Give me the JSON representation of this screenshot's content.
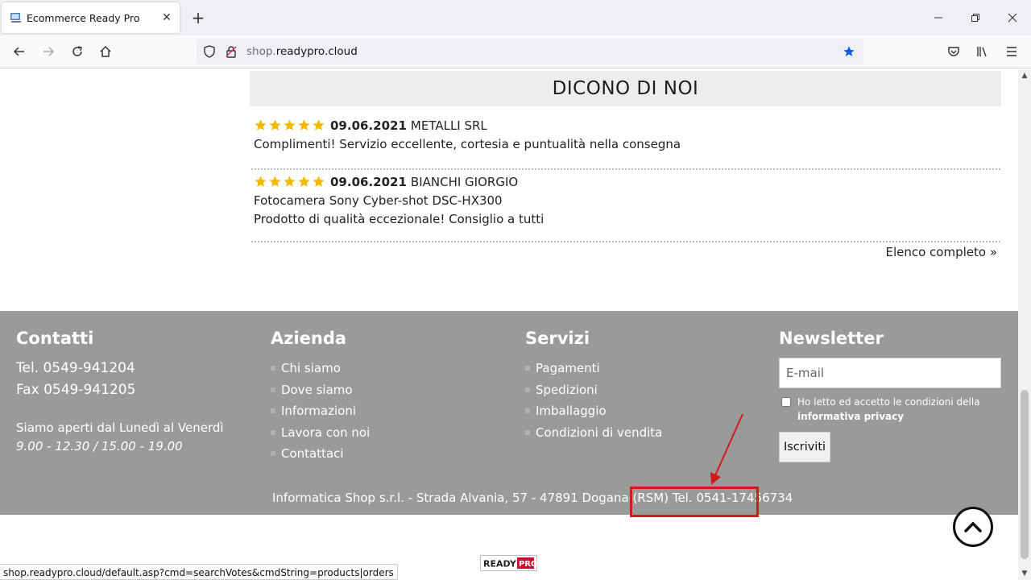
{
  "browser": {
    "tab_title": "Ecommerce Ready Pro",
    "url_host_dim": "shop.",
    "url_host_main": "readypro.cloud",
    "status_url": "shop.readypro.cloud/default.asp?cmd=searchVotes&cmdString=products|orders"
  },
  "reviews": {
    "heading": "DICONO DI NOI",
    "items": [
      {
        "rating": 5,
        "date": "09.06.2021",
        "author": "METALLI SRL",
        "lines": [
          "Complimenti! Servizio eccellente, cortesia e puntualità nella consegna"
        ]
      },
      {
        "rating": 5,
        "date": "09.06.2021",
        "author": "BIANCHI GIORGIO",
        "lines": [
          "Fotocamera Sony Cyber-shot DSC-HX300",
          "Prodotto di qualità eccezionale! Consiglio a tutti"
        ]
      }
    ],
    "full_list_link": "Elenco completo »"
  },
  "footer": {
    "contacts": {
      "title": "Contatti",
      "tel": "Tel. 0549-941204",
      "fax": "Fax 0549-941205",
      "hours_label": "Siamo aperti dal Lunedì al Venerdì",
      "hours": "9.00 - 12.30 / 15.00 - 19.00"
    },
    "company": {
      "title": "Azienda",
      "links": [
        "Chi siamo",
        "Dove siamo",
        "Informazioni",
        "Lavora con noi",
        "Contattaci"
      ]
    },
    "services": {
      "title": "Servizi",
      "links": [
        "Pagamenti",
        "Spedizioni",
        "Imballaggio",
        "Condizioni di vendita"
      ]
    },
    "newsletter": {
      "title": "Newsletter",
      "email_placeholder": "E-mail",
      "privacy_text": "Ho letto ed accetto le condizioni della",
      "privacy_link": "informativa privacy",
      "subscribe_label": "Iscriviti"
    },
    "address": "Informatica Shop s.r.l. - Strada Alvania, 57 - 47891 Dogana (RSM)",
    "address_tel": "Tel. 0541-17456734"
  },
  "colors": {
    "accent_star": "#f5b800",
    "footer_bg": "#9a9a9a",
    "highlight": "#d11a1a"
  }
}
